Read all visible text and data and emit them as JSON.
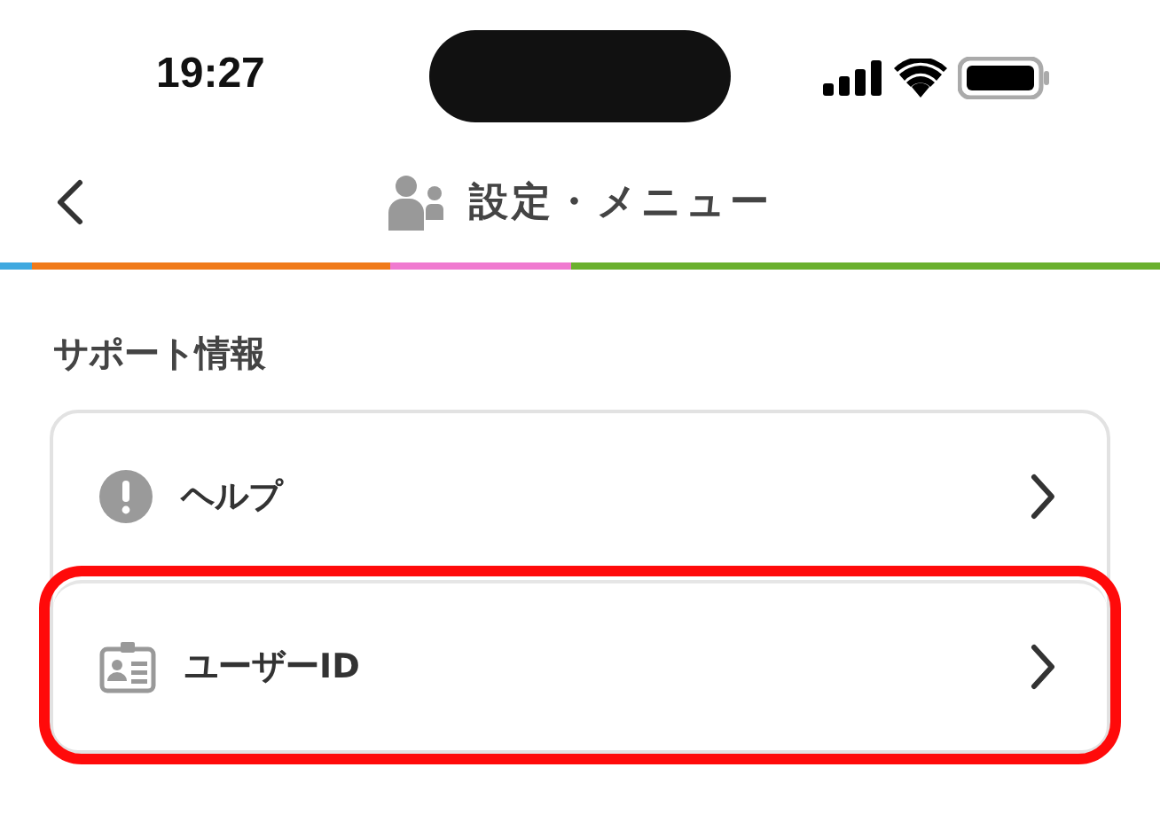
{
  "status_bar": {
    "time": "19:27"
  },
  "nav": {
    "title": "設定・メニュー"
  },
  "stripe": [
    {
      "color": "#3fa9e0"
    },
    {
      "color": "#f07a1a"
    },
    {
      "color": "#f07ad0"
    },
    {
      "color": "#6ab02e"
    }
  ],
  "section": {
    "title": "サポート情報"
  },
  "items": [
    {
      "kind": "help",
      "label": "ヘルプ",
      "highlighted": false
    },
    {
      "kind": "user-id",
      "label": "ユーザーID",
      "highlighted": true
    }
  ]
}
